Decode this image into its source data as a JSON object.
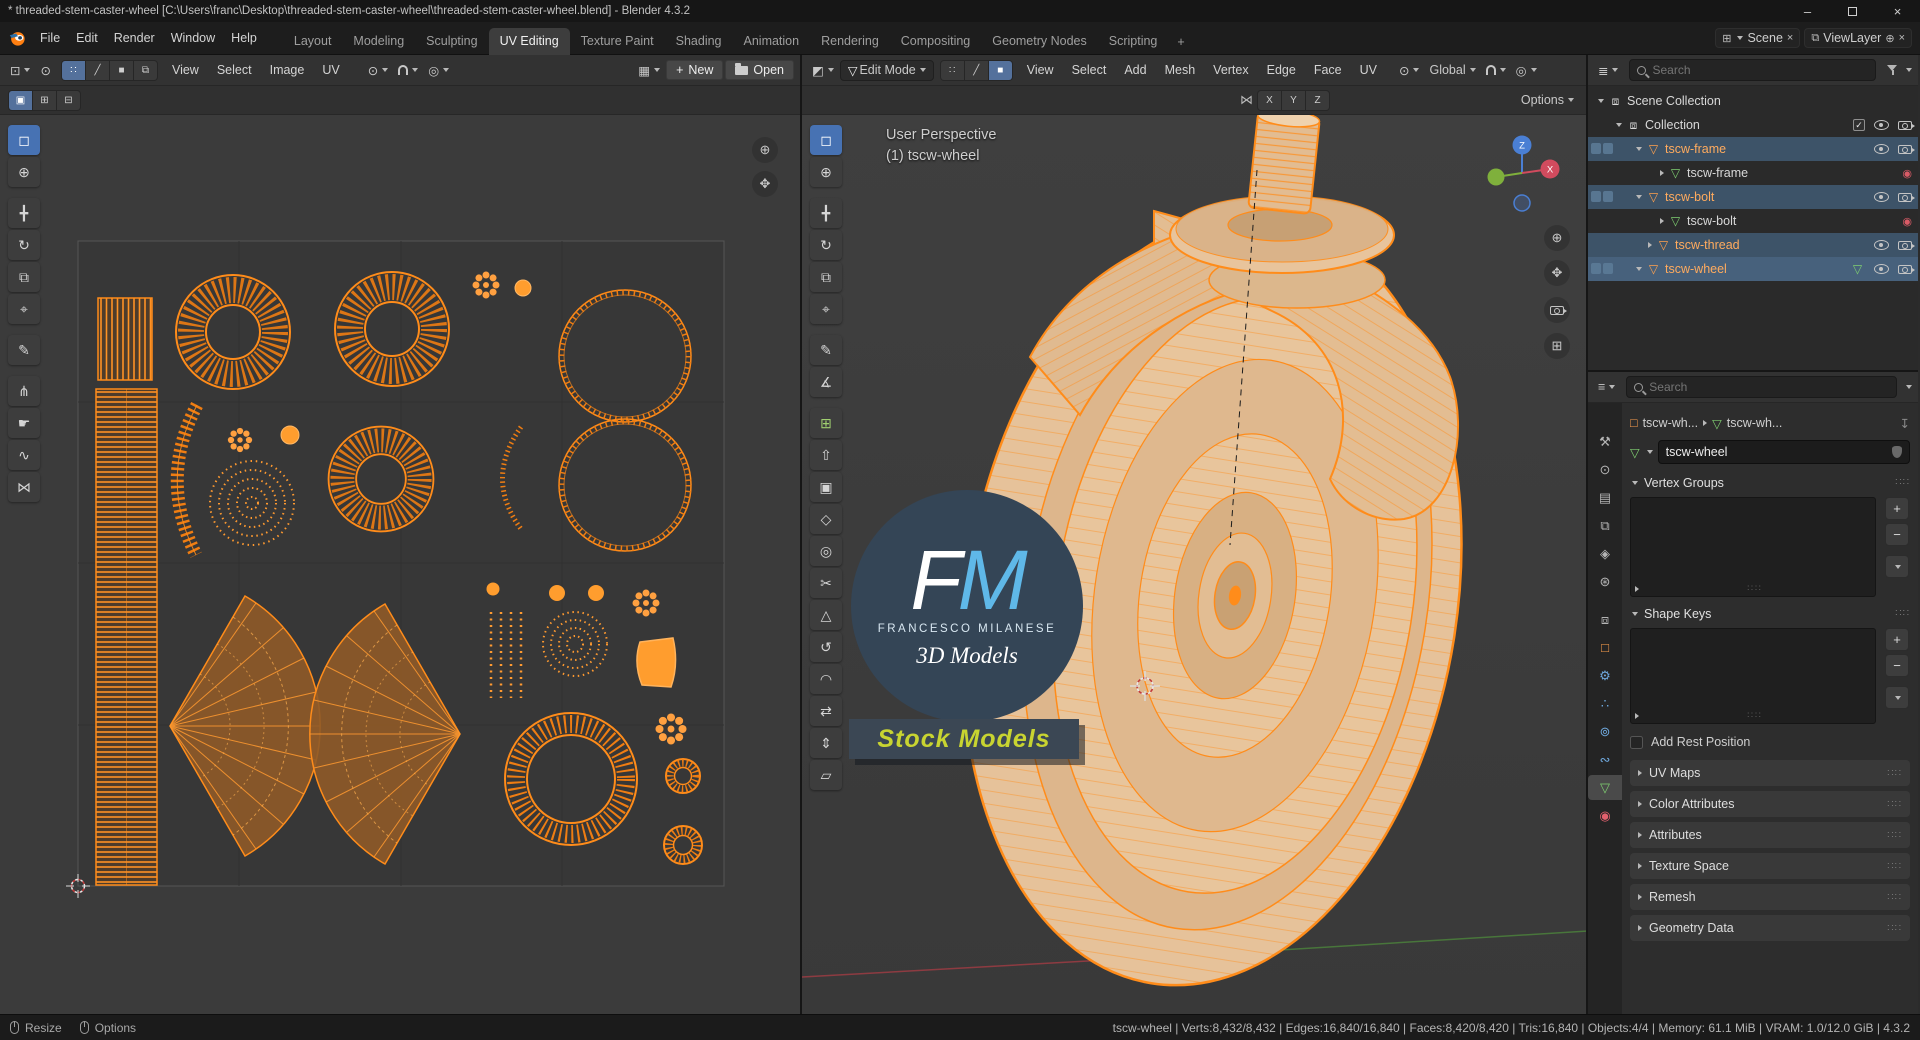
{
  "window": {
    "title": "* threaded-stem-caster-wheel [C:\\Users\\franc\\Desktop\\threaded-stem-caster-wheel\\threaded-stem-caster-wheel.blend] - Blender 4.3.2"
  },
  "colors": {
    "accent_orange": "#ff8c1a",
    "active_tool_blue": "#4772b3",
    "mesh_data_green": "#7fce71",
    "selected_row_blue": "#3d5368",
    "selected_name_orange": "#ffab5e",
    "watermark_blue": "#5fb8e8",
    "banner_yellow_green": "#c8d431"
  },
  "topbar": {
    "menus": [
      "File",
      "Edit",
      "Render",
      "Window",
      "Help"
    ],
    "workspaces": [
      "Layout",
      "Modeling",
      "Sculpting",
      "UV Editing",
      "Texture Paint",
      "Shading",
      "Animation",
      "Rendering",
      "Compositing",
      "Geometry Nodes",
      "Scripting"
    ],
    "active_workspace": "UV Editing",
    "add_workspace": "+",
    "scene": "Scene",
    "viewlayer": "ViewLayer"
  },
  "uv_editor": {
    "menus": [
      "View",
      "Select",
      "Image",
      "UV"
    ],
    "new_label": "New",
    "open_label": "Open",
    "tools": [
      {
        "name": "select-box",
        "glyph": "◻"
      },
      {
        "name": "cursor",
        "glyph": "⊕"
      },
      {
        "name": "move",
        "glyph": "╋"
      },
      {
        "name": "rotate",
        "glyph": "↻"
      },
      {
        "name": "scale",
        "glyph": "⧉"
      },
      {
        "name": "transform",
        "glyph": "⌖"
      },
      {
        "name": "annotate",
        "glyph": "✎"
      },
      {
        "name": "rip-region",
        "glyph": "⋔"
      },
      {
        "name": "grab",
        "glyph": "☛"
      },
      {
        "name": "relax",
        "glyph": "∿"
      },
      {
        "name": "pinch",
        "glyph": "⋈"
      }
    ]
  },
  "viewport": {
    "mode": "Edit Mode",
    "menus": [
      "View",
      "Select",
      "Add",
      "Mesh",
      "Vertex",
      "Edge",
      "Face",
      "UV"
    ],
    "orientation": "Global",
    "toolrow": {
      "axes": [
        "X",
        "Y",
        "Z"
      ],
      "options_label": "Options"
    },
    "overlay": {
      "line1": "User Perspective",
      "line2": "(1) tscw-wheel"
    },
    "gizmo": {
      "x": "X",
      "z": "Z"
    },
    "tools": [
      {
        "name": "select-box",
        "glyph": "◻"
      },
      {
        "name": "cursor",
        "glyph": "⊕"
      },
      {
        "name": "move",
        "glyph": "╋"
      },
      {
        "name": "rotate",
        "glyph": "↻"
      },
      {
        "name": "scale",
        "glyph": "⧉"
      },
      {
        "name": "transform",
        "glyph": "⌖"
      },
      {
        "name": "annotate",
        "glyph": "✎"
      },
      {
        "name": "measure",
        "glyph": "∡"
      },
      {
        "name": "add-cube",
        "glyph": "⊞"
      },
      {
        "name": "extrude-region",
        "glyph": "⇧"
      },
      {
        "name": "inset-faces",
        "glyph": "▣"
      },
      {
        "name": "bevel",
        "glyph": "◇"
      },
      {
        "name": "loop-cut",
        "glyph": "◎"
      },
      {
        "name": "knife",
        "glyph": "✂"
      },
      {
        "name": "poly-build",
        "glyph": "△"
      },
      {
        "name": "spin",
        "glyph": "↺"
      },
      {
        "name": "smooth",
        "glyph": "◠"
      },
      {
        "name": "edge-slide",
        "glyph": "⇄"
      },
      {
        "name": "shrink-fatten",
        "glyph": "⇕"
      },
      {
        "name": "shear",
        "glyph": "▱"
      }
    ]
  },
  "watermark": {
    "f": "F",
    "m": "M",
    "studio": "FRANCESCO MILANESE",
    "sub": "3D Models",
    "banner": "Stock Models"
  },
  "outliner": {
    "search_placeholder": "Search",
    "rows": [
      {
        "label": "Scene Collection"
      },
      {
        "label": "Collection"
      },
      {
        "label": "tscw-frame"
      },
      {
        "label": "tscw-frame"
      },
      {
        "label": "tscw-bolt"
      },
      {
        "label": "tscw-bolt"
      },
      {
        "label": "tscw-thread"
      },
      {
        "label": "tscw-wheel"
      }
    ]
  },
  "properties": {
    "search_placeholder": "Search",
    "breadcrumb": {
      "object": "tscw-wh...",
      "data": "tscw-wh..."
    },
    "name_value": "tscw-wheel",
    "vertex_groups_label": "Vertex Groups",
    "shape_keys_label": "Shape Keys",
    "add_rest_position_label": "Add Rest Position",
    "collapsed": [
      "UV Maps",
      "Color Attributes",
      "Attributes",
      "Texture Space",
      "Remesh",
      "Geometry Data"
    ]
  },
  "statusbar": {
    "resize_label": "Resize",
    "options_label": "Options",
    "stats": "tscw-wheel | Verts:8,432/8,432 | Edges:16,840/16,840 | Faces:8,420/8,420 | Tris:16,840 | Objects:4/4 | Memory: 61.1 MiB | VRAM: 1.0/12.0 GiB | 4.3.2"
  }
}
